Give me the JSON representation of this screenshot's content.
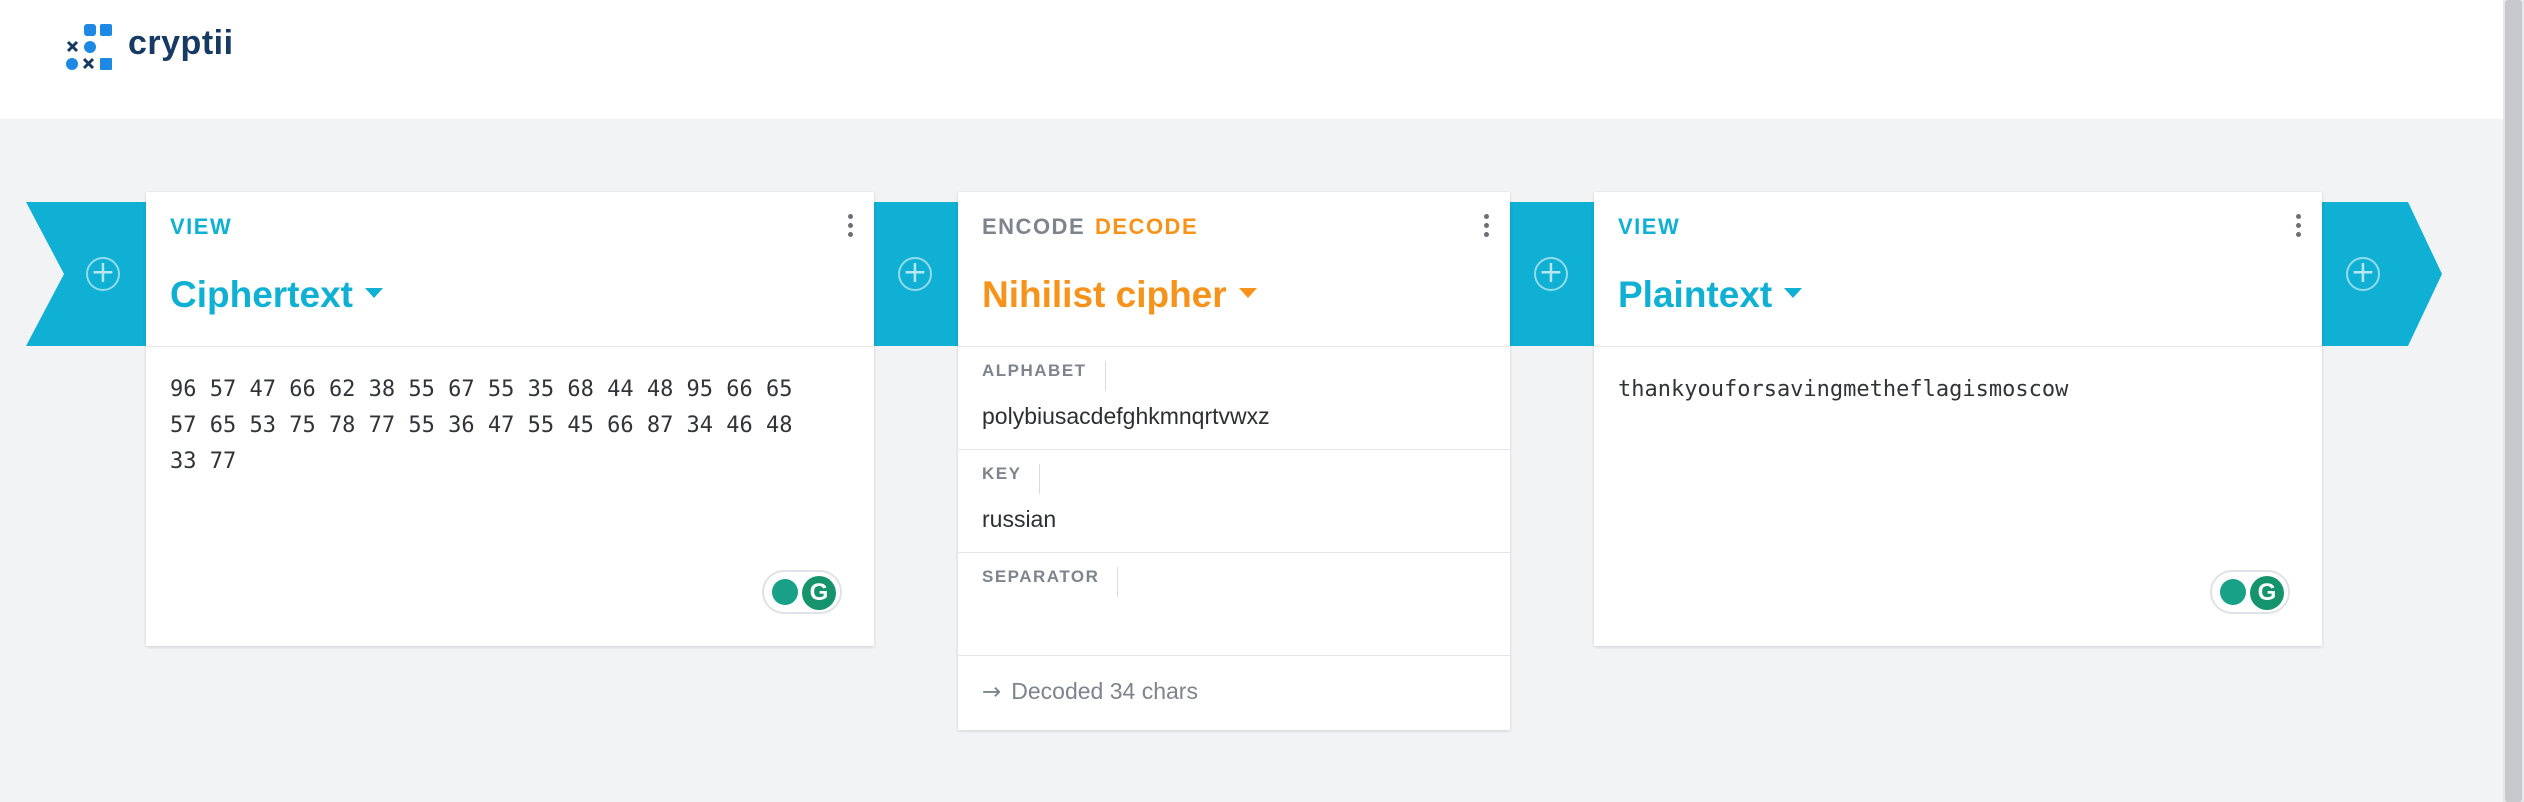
{
  "app": {
    "name": "cryptii"
  },
  "bricks": [
    {
      "tag": "VIEW",
      "title": "Ciphertext",
      "content_lines": [
        "96 57 47 66 62 38 55 67 55 35 68 44 48 95 66 65",
        "57 65 53 75 78 77 55 36 47 55 45 66 87 34 46 48",
        "33 77"
      ]
    },
    {
      "mode_encode": "ENCODE",
      "mode_decode": "DECODE",
      "title": "Nihilist cipher",
      "settings": [
        {
          "label": "ALPHABET",
          "value": "polybiusacdefghkmnqrtvwxz"
        },
        {
          "label": "KEY",
          "value": "russian"
        },
        {
          "label": "SEPARATOR",
          "value": ""
        }
      ],
      "status": "Decoded 34 chars"
    },
    {
      "tag": "VIEW",
      "title": "Plaintext",
      "content": "thankyouforsavingmetheflagismoscow"
    }
  ],
  "colors": {
    "accent_blue": "#0fb0d3",
    "accent_orange": "#f7931a",
    "logo_navy": "#173a63"
  }
}
